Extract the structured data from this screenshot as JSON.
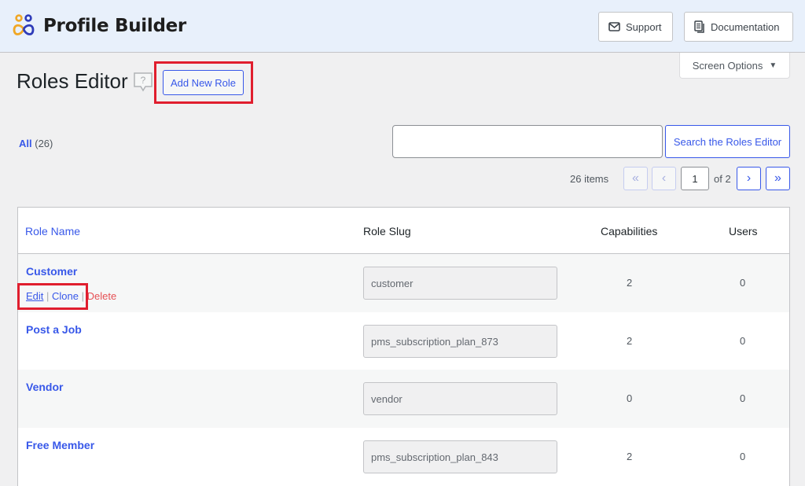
{
  "header": {
    "app_name": "Profile Builder",
    "support_label": "Support",
    "support_icon": "envelope-icon",
    "documentation_label": "Documentation",
    "documentation_icon": "document-icon"
  },
  "screen_options": {
    "label": "Screen Options",
    "icon": "caret-down-icon"
  },
  "page": {
    "title": "Roles Editor",
    "help_icon": "help-icon",
    "add_new_label": "Add New Role"
  },
  "filters": {
    "all_label": "All",
    "all_count": "(26)"
  },
  "search": {
    "value": "",
    "placeholder": "",
    "button_label": "Search the Roles Editor"
  },
  "pagination": {
    "items_text": "26 items",
    "first": "«",
    "prev": "‹",
    "current_page": "1",
    "of_text": "of 2",
    "next": "›",
    "last": "»"
  },
  "table": {
    "columns": [
      "Role Name",
      "Role Slug",
      "Capabilities",
      "Users"
    ],
    "row_actions": {
      "edit": "Edit",
      "clone": "Clone",
      "delete": "Delete",
      "separator": "|"
    },
    "rows": [
      {
        "name": "Customer",
        "slug": "customer",
        "capabilities": "2",
        "users": "0"
      },
      {
        "name": "Post a Job",
        "slug": "pms_subscription_plan_873",
        "capabilities": "2",
        "users": "0"
      },
      {
        "name": "Vendor",
        "slug": "vendor",
        "capabilities": "0",
        "users": "0"
      },
      {
        "name": "Free Member",
        "slug": "pms_subscription_plan_843",
        "capabilities": "2",
        "users": "0"
      }
    ]
  },
  "colors": {
    "accent": "#3858e9",
    "delete": "#e65054",
    "highlight": "#e01e2e",
    "header_bg": "#e8f0fb",
    "logo_orange": "#f0a725",
    "logo_blue": "#2e3bb8"
  }
}
